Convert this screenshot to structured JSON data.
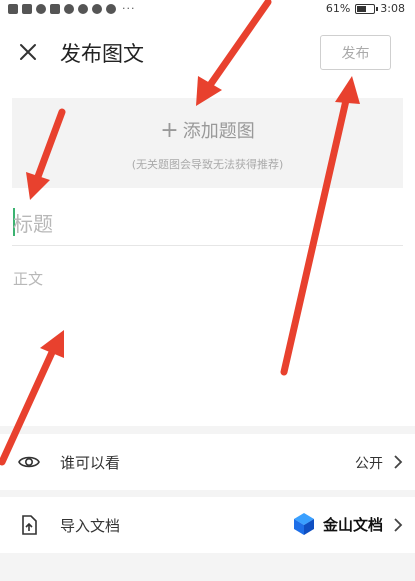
{
  "status_bar": {
    "battery_text": "61%",
    "battery_level": 0.61,
    "time": "3:08",
    "more": "···"
  },
  "header": {
    "title": "发布图文",
    "publish_label": "发布"
  },
  "add_image": {
    "label": "添加题图",
    "hint": "(无关题图会导致无法获得推荐)"
  },
  "editor": {
    "title_placeholder": "标题",
    "body_placeholder": "正文"
  },
  "settings": {
    "visibility_label": "谁可以看",
    "visibility_value": "公开",
    "import_label": "导入文档",
    "import_source": "金山文档"
  },
  "colors": {
    "annotation_arrow": "#e8412e",
    "caret": "#3cb371",
    "kingsoft_blue": "#1e6fe8"
  }
}
